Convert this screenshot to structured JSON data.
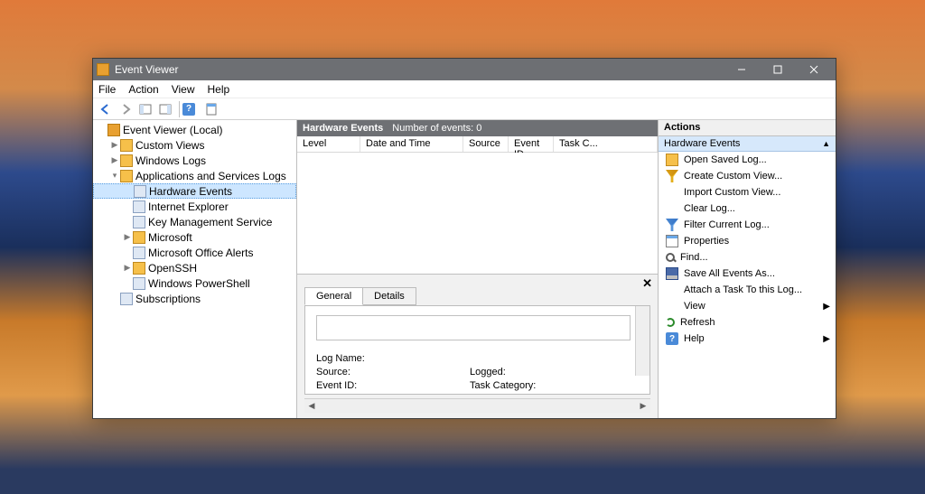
{
  "title": "Event Viewer",
  "menus": [
    "File",
    "Action",
    "View",
    "Help"
  ],
  "tree": {
    "root": "Event Viewer (Local)",
    "custom": "Custom Views",
    "windows": "Windows Logs",
    "apps": "Applications and Services Logs",
    "hardware": "Hardware Events",
    "ie": "Internet Explorer",
    "kms": "Key Management Service",
    "ms": "Microsoft",
    "alerts": "Microsoft Office Alerts",
    "ssh": "OpenSSH",
    "ps": "Windows PowerShell",
    "subs": "Subscriptions"
  },
  "center": {
    "title": "Hardware Events",
    "count_label": "Number of events: 0",
    "cols": {
      "level": "Level",
      "date": "Date and Time",
      "source": "Source",
      "eventid": "Event ID",
      "taskc": "Task C..."
    }
  },
  "detail": {
    "tab_general": "General",
    "tab_details": "Details",
    "logname": "Log Name:",
    "source": "Source:",
    "logged": "Logged:",
    "eventid": "Event ID:",
    "taskcat": "Task Category:"
  },
  "actions": {
    "header": "Actions",
    "group": "Hardware Events",
    "open": "Open Saved Log...",
    "create": "Create Custom View...",
    "import": "Import Custom View...",
    "clear": "Clear Log...",
    "filter": "Filter Current Log...",
    "props": "Properties",
    "find": "Find...",
    "save": "Save All Events As...",
    "attach": "Attach a Task To this Log...",
    "view": "View",
    "refresh": "Refresh",
    "help": "Help"
  }
}
